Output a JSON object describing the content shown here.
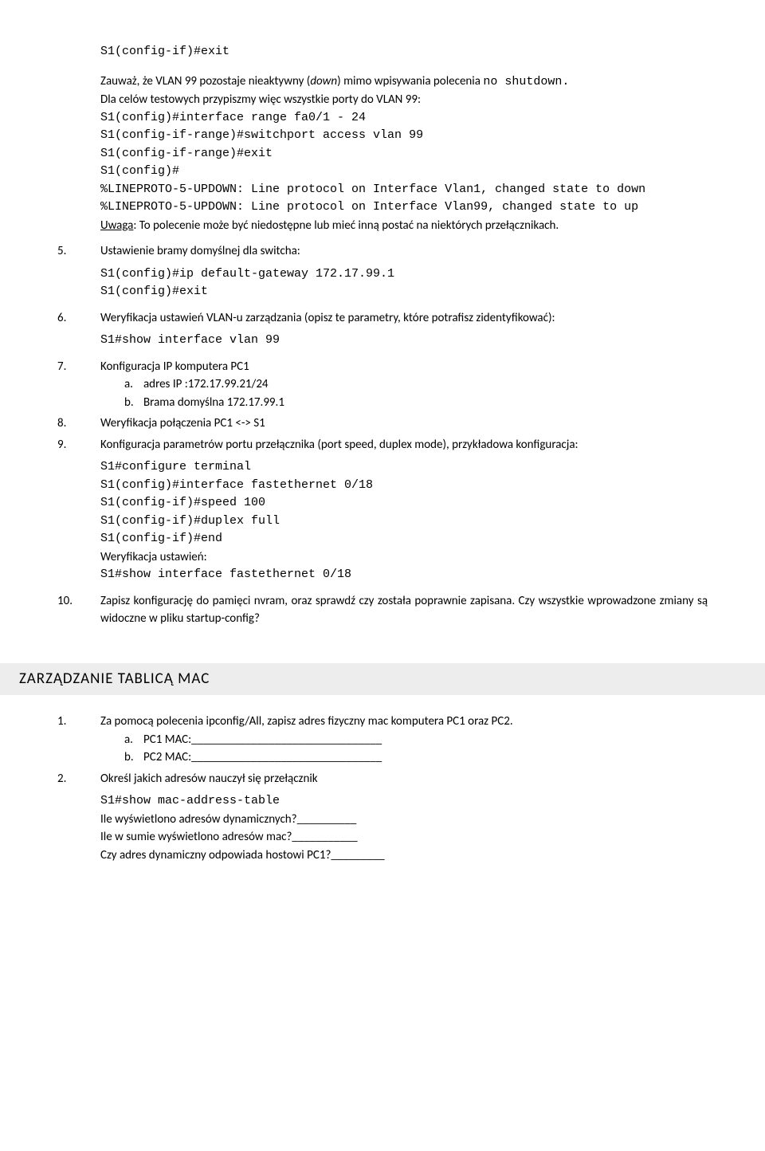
{
  "intro": {
    "line0": "S1(config-if)#exit",
    "p1a": "Zauważ, że VLAN 99 pozostaje nieaktywny (",
    "p1b": "down",
    "p1c": ") mimo wpisywania polecenia ",
    "p1d": "no shutdown. ",
    "p2": "Dla celów testowych przypiszmy więc wszystkie porty do VLAN 99:",
    "c1": "S1(config)#interface range fa0/1 - 24",
    "c2": "S1(config-if-range)#switchport access vlan 99",
    "c3": "S1(config-if-range)#exit",
    "c4": "S1(config)#",
    "c5": "%LINEPROTO-5-UPDOWN: Line protocol on Interface Vlan1, changed state to down",
    "c6": "%LINEPROTO-5-UPDOWN: Line protocol on Interface Vlan99, changed state to up",
    "note_label": "Uwaga",
    "note_text": ": To polecenie może być niedostępne lub mieć inną postać na niektórych przełącznikach."
  },
  "s5": {
    "num": "5.",
    "text": "Ustawienie bramy domyślnej dla switcha:",
    "c1": "S1(config)#ip default-gateway 172.17.99.1",
    "c2": "S1(config)#exit"
  },
  "s6": {
    "num": "6.",
    "text": "Weryfikacja ustawień VLAN-u zarządzania (opisz te parametry, które potrafisz zidentyfikować):",
    "c1": "S1#show interface vlan 99"
  },
  "s7": {
    "num": "7.",
    "text": "Konfiguracja IP komputera PC1",
    "a_num": "a.",
    "a_text": "adres IP :172.17.99.21/24",
    "b_num": "b.",
    "b_text": "Brama domyślna 172.17.99.1"
  },
  "s8": {
    "num": "8.",
    "text": "Weryfikacja połączenia PC1 <-> S1"
  },
  "s9": {
    "num": "9.",
    "text": "Konfiguracja parametrów portu przełącznika (port speed, duplex mode), przykładowa konfiguracja:",
    "c1": "S1#configure terminal",
    "c2": "S1(config)#interface fastethernet 0/18",
    "c3": "S1(config-if)#speed 100",
    "c4": "S1(config-if)#duplex full",
    "c5": "S1(config-if)#end",
    "verify": "Weryfikacja ustawień:",
    "c6": "S1#show interface fastethernet 0/18"
  },
  "s10": {
    "num": "10.",
    "text": "Zapisz konfigurację do pamięci nvram, oraz sprawdź czy została poprawnie zapisana. Czy wszystkie wprowadzone zmiany są widoczne w pliku startup-config?"
  },
  "mac": {
    "heading": "ZARZĄDZANIE TABLICĄ MAC",
    "s1": {
      "num": "1.",
      "text": "Za pomocą polecenia ipconfig/All, zapisz adres fizyczny mac komputera PC1 oraz PC2.",
      "a_num": "a.",
      "a_text": "PC1 MAC:________________________________",
      "b_num": "b.",
      "b_text": "PC2 MAC:________________________________"
    },
    "s2": {
      "num": "2.",
      "text": "Określ jakich adresów nauczył się przełącznik",
      "c1": "S1#show mac-address-table",
      "q1": "Ile wyświetlono adresów dynamicznych?__________",
      "q2": "Ile w sumie wyświetlono adresów mac?___________",
      "q3": "Czy adres dynamiczny odpowiada hostowi PC1?_________"
    }
  }
}
